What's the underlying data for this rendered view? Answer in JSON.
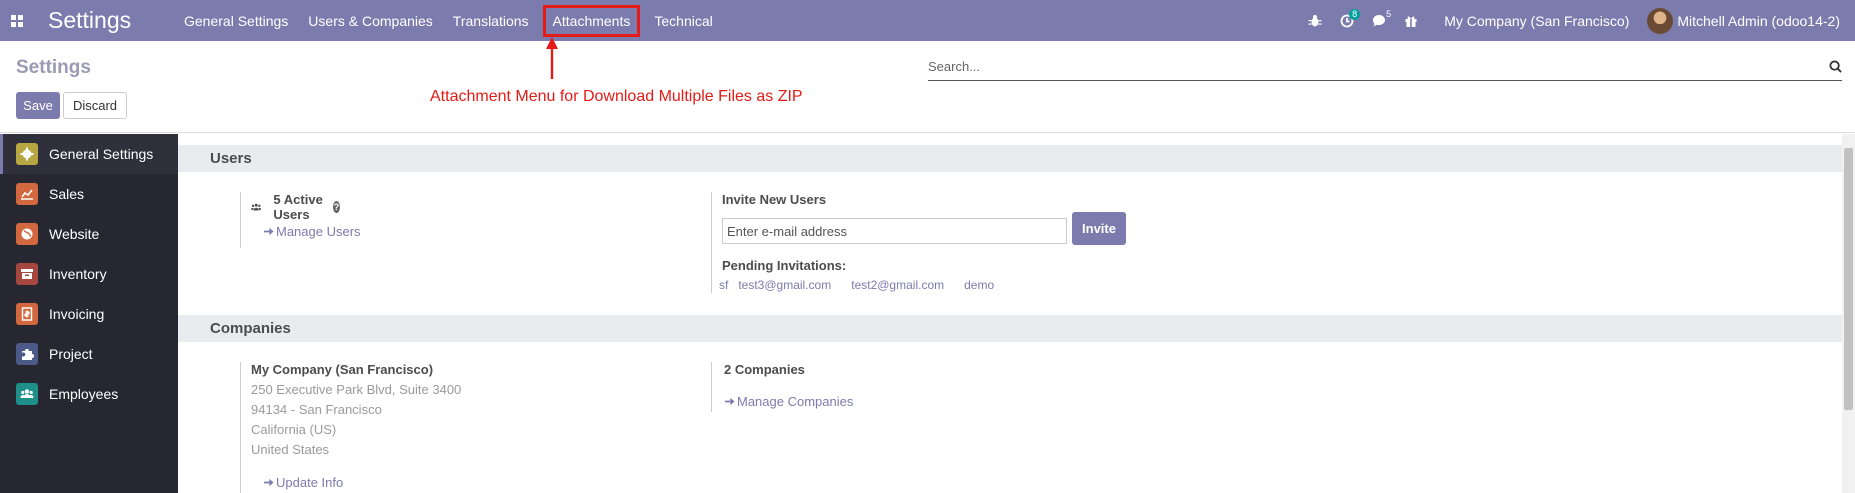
{
  "navbar": {
    "brand": "Settings",
    "menu": [
      "General Settings",
      "Users & Companies",
      "Translations",
      "Attachments",
      "Technical"
    ],
    "activity_count": "8",
    "messages_count": "5",
    "company": "My Company (San Francisco)",
    "user": "Mitchell Admin (odoo14-2)"
  },
  "annotation": "Attachment Menu for Download Multiple Files as ZIP",
  "control": {
    "title": "Settings",
    "save": "Save",
    "discard": "Discard",
    "search_placeholder": "Search..."
  },
  "sidebar": {
    "items": [
      {
        "label": "General Settings",
        "icon": "gear-icon",
        "color": "#b6a743"
      },
      {
        "label": "Sales",
        "icon": "chart-icon",
        "color": "#d2683f"
      },
      {
        "label": "Website",
        "icon": "globe-icon",
        "color": "#d2683f"
      },
      {
        "label": "Inventory",
        "icon": "box-icon",
        "color": "#a5473f"
      },
      {
        "label": "Invoicing",
        "icon": "invoice-icon",
        "color": "#d2683f"
      },
      {
        "label": "Project",
        "icon": "puzzle-icon",
        "color": "#4c5a8a"
      },
      {
        "label": "Employees",
        "icon": "users-icon",
        "color": "#1f8f8a"
      }
    ]
  },
  "users": {
    "heading": "Users",
    "active_users": "5 Active Users",
    "manage_users": "Manage Users",
    "invite_title": "Invite New Users",
    "invite_placeholder": "Enter e-mail address",
    "invite_button": "Invite",
    "pending_title": "Pending Invitations:",
    "pending": [
      "sf",
      "test3@gmail.com",
      "test2@gmail.com",
      "demo"
    ]
  },
  "companies": {
    "heading": "Companies",
    "company_name": "My Company (San Francisco)",
    "address": [
      "250 Executive Park Blvd, Suite 3400",
      "94134 - San Francisco",
      "California (US)",
      "United States"
    ],
    "update_info": "Update Info",
    "count": "2 Companies",
    "manage": "Manage Companies"
  },
  "colors": {
    "primary": "#7c7bad",
    "sidebar_bg": "#262730",
    "annotation": "#e41b17"
  }
}
